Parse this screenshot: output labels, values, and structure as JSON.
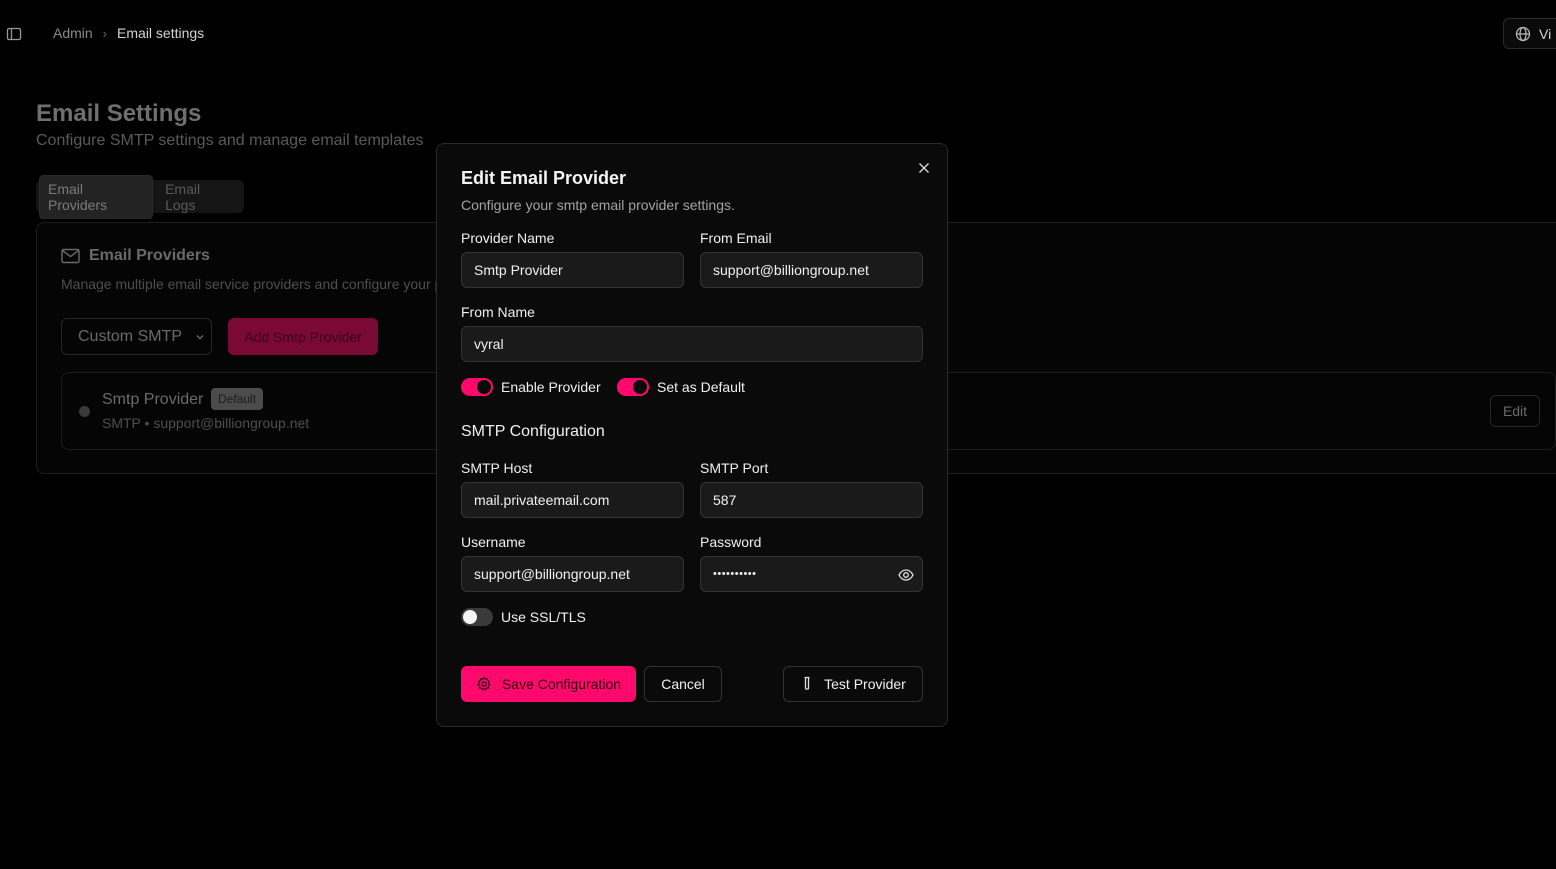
{
  "topbar": {
    "breadcrumb": {
      "root": "Admin",
      "current": "Email settings"
    },
    "language_label": "Vi"
  },
  "page": {
    "title": "Email Settings",
    "subtitle": "Configure SMTP settings and manage email templates",
    "tabs": [
      {
        "label": "Email Providers",
        "active": true
      },
      {
        "label": "Email Logs",
        "active": false
      }
    ],
    "card": {
      "title": "Email Providers",
      "subtitle": "Manage multiple email service providers and configure your p",
      "select_value": "Custom SMTP",
      "add_button": "Add Smtp Provider",
      "provider": {
        "name": "Smtp Provider",
        "badge": "Default",
        "meta": "SMTP • support@billiongroup.net",
        "edit_label": "Edit"
      }
    }
  },
  "modal": {
    "title": "Edit Email Provider",
    "description": "Configure your smtp email provider settings.",
    "fields": {
      "provider_name": {
        "label": "Provider Name",
        "value": "Smtp Provider"
      },
      "from_email": {
        "label": "From Email",
        "value": "support@billiongroup.net"
      },
      "from_name": {
        "label": "From Name",
        "value": "vyral"
      },
      "smtp_host": {
        "label": "SMTP Host",
        "value": "mail.privateemail.com"
      },
      "smtp_port": {
        "label": "SMTP Port",
        "value": "587"
      },
      "username": {
        "label": "Username",
        "value": "support@billiongroup.net"
      },
      "password": {
        "label": "Password",
        "value": "••••••••••"
      }
    },
    "toggles": {
      "enable_provider": {
        "label": "Enable Provider",
        "on": true
      },
      "set_default": {
        "label": "Set as Default",
        "on": true
      },
      "use_ssl": {
        "label": "Use SSL/TLS",
        "on": false
      }
    },
    "section_title": "SMTP Configuration",
    "buttons": {
      "save": "Save Configuration",
      "cancel": "Cancel",
      "test": "Test Provider"
    }
  },
  "colors": {
    "accent": "#ff0a6c",
    "background": "#000000",
    "modal_bg": "#0a0a0a"
  }
}
